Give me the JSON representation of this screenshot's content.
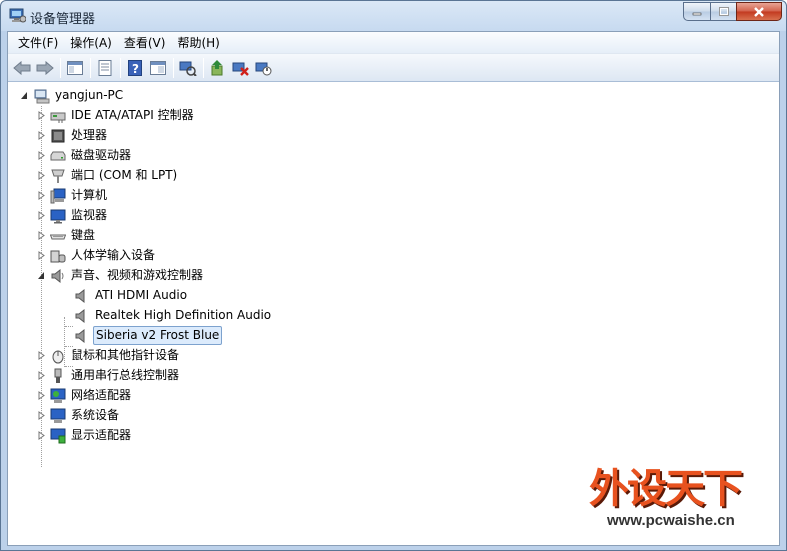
{
  "window": {
    "title": "设备管理器"
  },
  "menu": [
    "文件(F)",
    "操作(A)",
    "查看(V)",
    "帮助(H)"
  ],
  "toolbar_icons": [
    "back-arrow-icon",
    "forward-arrow-icon",
    "console-tree-icon",
    "properties-icon",
    "help-icon",
    "view-icon",
    "scan-hardware-icon",
    "update-driver-icon",
    "uninstall-icon",
    "disable-icon"
  ],
  "tree": {
    "root": "yangjun-PC",
    "categories": [
      {
        "label": "IDE ATA/ATAPI 控制器",
        "icon": "ide-controller-icon",
        "expanded": false
      },
      {
        "label": "处理器",
        "icon": "processor-icon",
        "expanded": false
      },
      {
        "label": "磁盘驱动器",
        "icon": "disk-drive-icon",
        "expanded": false
      },
      {
        "label": "端口 (COM 和 LPT)",
        "icon": "port-icon",
        "expanded": false
      },
      {
        "label": "计算机",
        "icon": "computer-icon",
        "expanded": false
      },
      {
        "label": "监视器",
        "icon": "monitor-icon",
        "expanded": false
      },
      {
        "label": "键盘",
        "icon": "keyboard-icon",
        "expanded": false
      },
      {
        "label": "人体学输入设备",
        "icon": "hid-icon",
        "expanded": false
      },
      {
        "label": "声音、视频和游戏控制器",
        "icon": "speaker-icon",
        "expanded": true
      },
      {
        "label": "鼠标和其他指针设备",
        "icon": "mouse-icon",
        "expanded": false
      },
      {
        "label": "通用串行总线控制器",
        "icon": "usb-icon",
        "expanded": false
      },
      {
        "label": "网络适配器",
        "icon": "network-adapter-icon",
        "expanded": false
      },
      {
        "label": "系统设备",
        "icon": "system-device-icon",
        "expanded": false
      },
      {
        "label": "显示适配器",
        "icon": "display-adapter-icon",
        "expanded": false
      }
    ],
    "sound_children": [
      "ATI HDMI Audio",
      "Realtek High Definition Audio",
      "Siberia v2 Frost Blue"
    ],
    "selected": "Siberia v2 Frost Blue"
  },
  "watermark": {
    "title": "外设天下",
    "url": "www.pcwaishe.cn"
  }
}
